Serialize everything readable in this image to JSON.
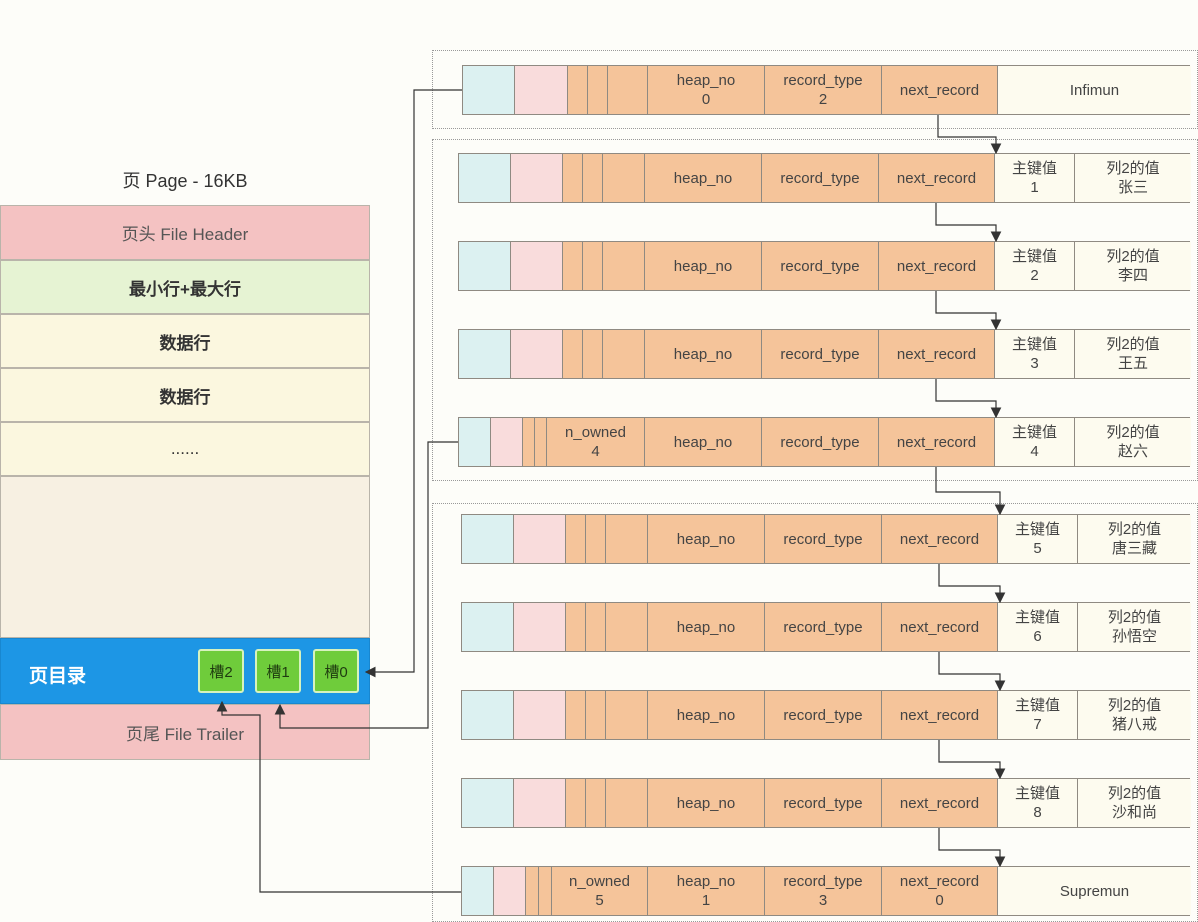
{
  "page": {
    "title": "页 Page - 16KB",
    "header": "页头 File Header",
    "inf_sup": "最小行+最大行",
    "data_row_1": "数据行",
    "data_row_2": "数据行",
    "ellipsis": "......",
    "directory": "页目录",
    "slots": [
      "槽2",
      "槽1",
      "槽0"
    ],
    "trailer": "页尾 File Trailer"
  },
  "labels": {
    "heap_no": "heap_no",
    "record_type": "record_type",
    "next_record": "next_record",
    "n_owned": "n_owned",
    "pk": "主键值",
    "col2": "列2的值"
  },
  "colors": {
    "header_pink": "#f4c2c2",
    "infsup_green": "#e6f3d3",
    "datarow_cream": "#fbf7df",
    "directory_blue": "#1d96e5",
    "slot_green": "#6fcc3b",
    "field_orange": "#f5c49a",
    "field_cyan": "#dcf1f1",
    "field_pink": "#f9dcdc"
  },
  "records": {
    "infimum": {
      "heap_no": "0",
      "record_type": "2",
      "name": "Infimun"
    },
    "rows": [
      {
        "pk": "1",
        "col2": "张三"
      },
      {
        "pk": "2",
        "col2": "李四"
      },
      {
        "pk": "3",
        "col2": "王五"
      },
      {
        "pk": "4",
        "col2": "赵六",
        "n_owned": "4"
      },
      {
        "pk": "5",
        "col2": "唐三藏"
      },
      {
        "pk": "6",
        "col2": "孙悟空"
      },
      {
        "pk": "7",
        "col2": "猪八戒"
      },
      {
        "pk": "8",
        "col2": "沙和尚"
      }
    ],
    "supremum": {
      "n_owned": "5",
      "heap_no": "1",
      "record_type": "3",
      "next_record": "0",
      "name": "Supremun"
    }
  }
}
